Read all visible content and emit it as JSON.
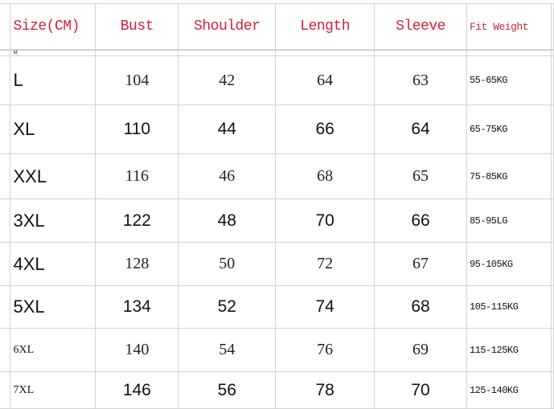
{
  "table": {
    "headers": [
      "Size(CM)",
      "Bust",
      "Shoulder",
      "Length",
      "Sleeve",
      "Fit Weight"
    ],
    "header_color": "#d0203a",
    "marker": "M",
    "rows": [
      {
        "style": "serif",
        "cells": [
          "L",
          "104",
          "42",
          "64",
          "63",
          "55-65KG"
        ]
      },
      {
        "style": "sans",
        "cells": [
          "XL",
          "110",
          "44",
          "66",
          "64",
          "65-75KG"
        ]
      },
      {
        "style": "serif",
        "cells": [
          "XXL",
          "116",
          "46",
          "68",
          "65",
          "75-85KG"
        ]
      },
      {
        "style": "sans",
        "cells": [
          "3XL",
          "122",
          "48",
          "70",
          "66",
          "85-95LG"
        ]
      },
      {
        "style": "serif",
        "cells": [
          "4XL",
          "128",
          "50",
          "72",
          "67",
          "95-105KG"
        ]
      },
      {
        "style": "sans",
        "cells": [
          "5XL",
          "134",
          "52",
          "74",
          "68",
          "105-115KG"
        ]
      },
      {
        "style": "serif small",
        "cells": [
          "6XL",
          "140",
          "54",
          "76",
          "69",
          "115-125KG"
        ]
      },
      {
        "style": "sans small",
        "cells": [
          "7XL",
          "146",
          "56",
          "78",
          "70",
          "125-140KG"
        ]
      }
    ]
  }
}
